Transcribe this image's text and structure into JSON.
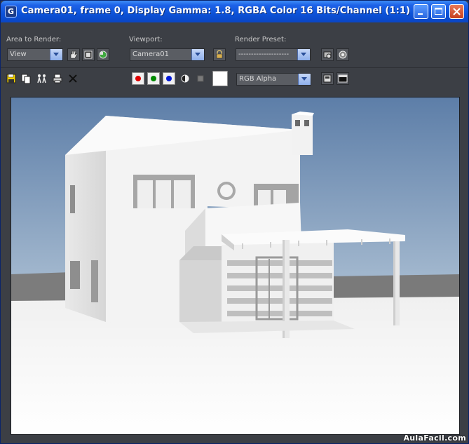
{
  "window": {
    "title": "Camera01, frame 0, Display Gamma: 1.8, RGBA Color 16 Bits/Channel (1:1)",
    "app_icon_glyph": "G"
  },
  "toolbar": {
    "area_label": "Area to Render:",
    "area_value": "View",
    "viewport_label": "Viewport:",
    "viewport_value": "Camera01",
    "preset_label": "Render Preset:",
    "preset_value": "--------------------",
    "channel_value": "RGB Alpha",
    "icons_row1": [
      "edit-region-icon",
      "auto-region-icon",
      "render-icon",
      "lock-icon",
      "render-setup-icon",
      "environment-icon"
    ],
    "icons_row2": [
      "save-icon",
      "copy-icon",
      "clone-window-icon",
      "print-icon",
      "clear-icon",
      "mono-icon",
      "alpha-toggle-icon",
      "display-toggle-icon",
      "frame-buffer-icon"
    ],
    "channels": [
      {
        "name": "red",
        "color": "#e00000"
      },
      {
        "name": "green",
        "color": "#008a00"
      },
      {
        "name": "blue",
        "color": "#0018d8"
      }
    ],
    "swatch_color": "#ffffff"
  },
  "watermark": "AulaFacil.com"
}
